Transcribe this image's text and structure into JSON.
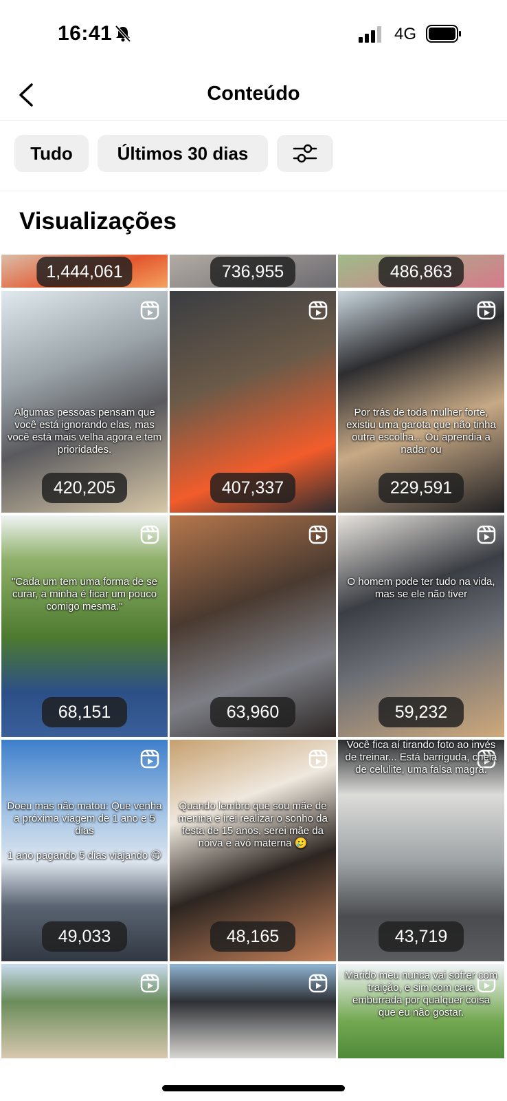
{
  "status_bar": {
    "time": "16:41",
    "network": "4G",
    "icons": [
      "bell-muted-icon",
      "signal-icon",
      "battery-icon"
    ]
  },
  "header": {
    "title": "Conteúdo",
    "back_icon": "chevron-left-icon"
  },
  "filters": {
    "all_label": "Tudo",
    "period_label": "Últimos 30 dias",
    "filter_icon": "sliders-icon"
  },
  "section": {
    "title": "Visualizações"
  },
  "colors": {
    "chip_bg": "#efefef",
    "badge_bg": "#1e1e1e",
    "text": "#000000"
  },
  "grid": {
    "rows": [
      [
        {
          "views": "1,444,061",
          "caption": ""
        },
        {
          "views": "736,955",
          "caption": ""
        },
        {
          "views": "486,863",
          "caption": ""
        }
      ],
      [
        {
          "views": "420,205",
          "caption": "Algumas pessoas pensam que você está ignorando elas, mas você está mais velha agora e tem prioridades."
        },
        {
          "views": "407,337",
          "caption": ""
        },
        {
          "views": "229,591",
          "caption": "Por trás de toda mulher forte, existiu uma garota que não tinha outra escolha... Ou aprendia a nadar ou"
        }
      ],
      [
        {
          "views": "68,151",
          "caption": "\"Cada um tem uma forma de se curar, a minha é ficar um pouco comigo mesma.\""
        },
        {
          "views": "63,960",
          "caption": ""
        },
        {
          "views": "59,232",
          "caption": "O homem pode ter tudo na vida, mas se ele não tiver"
        }
      ],
      [
        {
          "views": "49,033",
          "caption": "Doeu mas não matou: Que venha a próxima viagem de 1 ano e 5 dias\n\n1 ano pagando 5 dias viajando 😋"
        },
        {
          "views": "48,165",
          "caption": "Quando lembro que sou mãe de menina e irei realizar o sonho da festa de 15 anos, serei mãe da noiva e avó materna 🥲"
        },
        {
          "views": "43,719",
          "caption": "Pov: Minha personal\n\nVocê fica aí tirando foto ao invés de treinar... Está barriguda, cheia de celulite, uma falsa magra."
        }
      ],
      [
        {
          "views": "",
          "caption": ""
        },
        {
          "views": "",
          "caption": ""
        },
        {
          "views": "",
          "caption": "Marido meu nunca vai sofrer com traição, e sim com cara emburrada por qualquer coisa que eu não gostar."
        }
      ]
    ]
  }
}
